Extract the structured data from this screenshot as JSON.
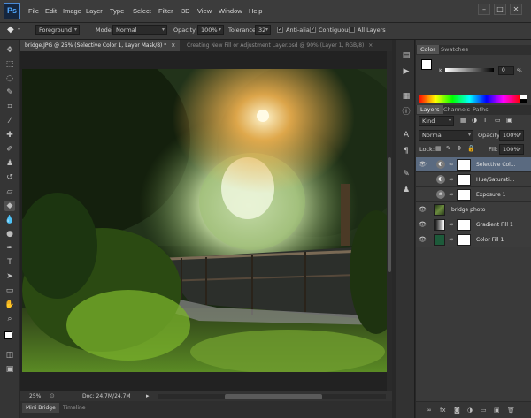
{
  "app": {
    "logo": "Ps"
  },
  "menu": [
    "File",
    "Edit",
    "Image",
    "Layer",
    "Type",
    "Select",
    "Filter",
    "3D",
    "View",
    "Window",
    "Help"
  ],
  "window_controls": [
    "–",
    "□",
    "✕"
  ],
  "options": {
    "fill_source": "Foreground",
    "mode_label": "Mode:",
    "mode_value": "Normal",
    "opacity_label": "Opacity:",
    "opacity_value": "100%",
    "tolerance_label": "Tolerance:",
    "tolerance_value": "32",
    "antialias_label": "Anti-alias",
    "contiguous_label": "Contiguous",
    "all_layers_label": "All Layers"
  },
  "document_tabs": [
    {
      "label": "bridge.JPG @ 25% (Selective Color 1, Layer Mask/8) *",
      "close": "×"
    },
    {
      "label": "Creating New Fill or Adjustment Layer.psd @ 90% (Layer 1, RGB/8)",
      "close": "×"
    }
  ],
  "status": {
    "zoom": "25%",
    "doc": "Doc: 24.7M/24.7M"
  },
  "bottom_tabs": [
    "Mini Bridge",
    "Timeline"
  ],
  "color_panel": {
    "tabs": [
      "Color",
      "Swatches"
    ],
    "channel": "K",
    "value": "0",
    "unit": "%"
  },
  "layers_panel": {
    "tabs": [
      "Layers",
      "Channels",
      "Paths"
    ],
    "kind": "Kind",
    "blend_mode": "Normal",
    "opacity_label": "Opacity:",
    "opacity_value": "100%",
    "lock_label": "Lock:",
    "fill_label": "Fill:",
    "fill_value": "100%",
    "layers": [
      {
        "name": "Selective Col...",
        "type": "adjustment",
        "visible": true,
        "selected": true
      },
      {
        "name": "Hue/Saturati...",
        "type": "adjustment",
        "visible": false,
        "selected": false
      },
      {
        "name": "Exposure 1",
        "type": "adjustment",
        "visible": false,
        "selected": false
      },
      {
        "name": "bridge photo",
        "type": "image",
        "visible": true,
        "selected": false
      },
      {
        "name": "Gradient Fill 1",
        "type": "gradient",
        "visible": true,
        "selected": false
      },
      {
        "name": "Color Fill 1",
        "type": "color",
        "visible": true,
        "selected": false
      }
    ],
    "footer_icons": [
      "link-icon",
      "fx-icon",
      "mask-icon",
      "adjustment-icon",
      "folder-icon",
      "new-layer-icon",
      "trash-icon"
    ]
  },
  "colors": {
    "accent": "#4fa8ff",
    "selected_layer": "#5a6a80",
    "color_fill": "#1d5a3a"
  }
}
